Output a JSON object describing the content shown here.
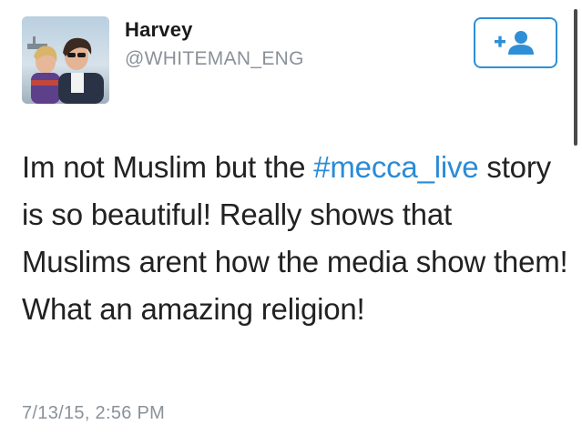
{
  "user": {
    "display_name": "Harvey",
    "handle": "@WHITEMAN_ENG"
  },
  "follow_button": {
    "icon": "add-user-icon",
    "label": "+"
  },
  "tweet": {
    "text_before_hashtag": "Im not Muslim but the ",
    "hashtag": "#mecca_live",
    "text_after_hashtag": " story is so beautiful! Really shows that Muslims arent how the media show them! What an amazing religion!",
    "timestamp": "7/13/15, 2:56 PM"
  },
  "colors": {
    "link": "#2b8bd6",
    "button_border": "#2f8fd6",
    "secondary_text": "#8a9199",
    "primary_text": "#222222"
  }
}
